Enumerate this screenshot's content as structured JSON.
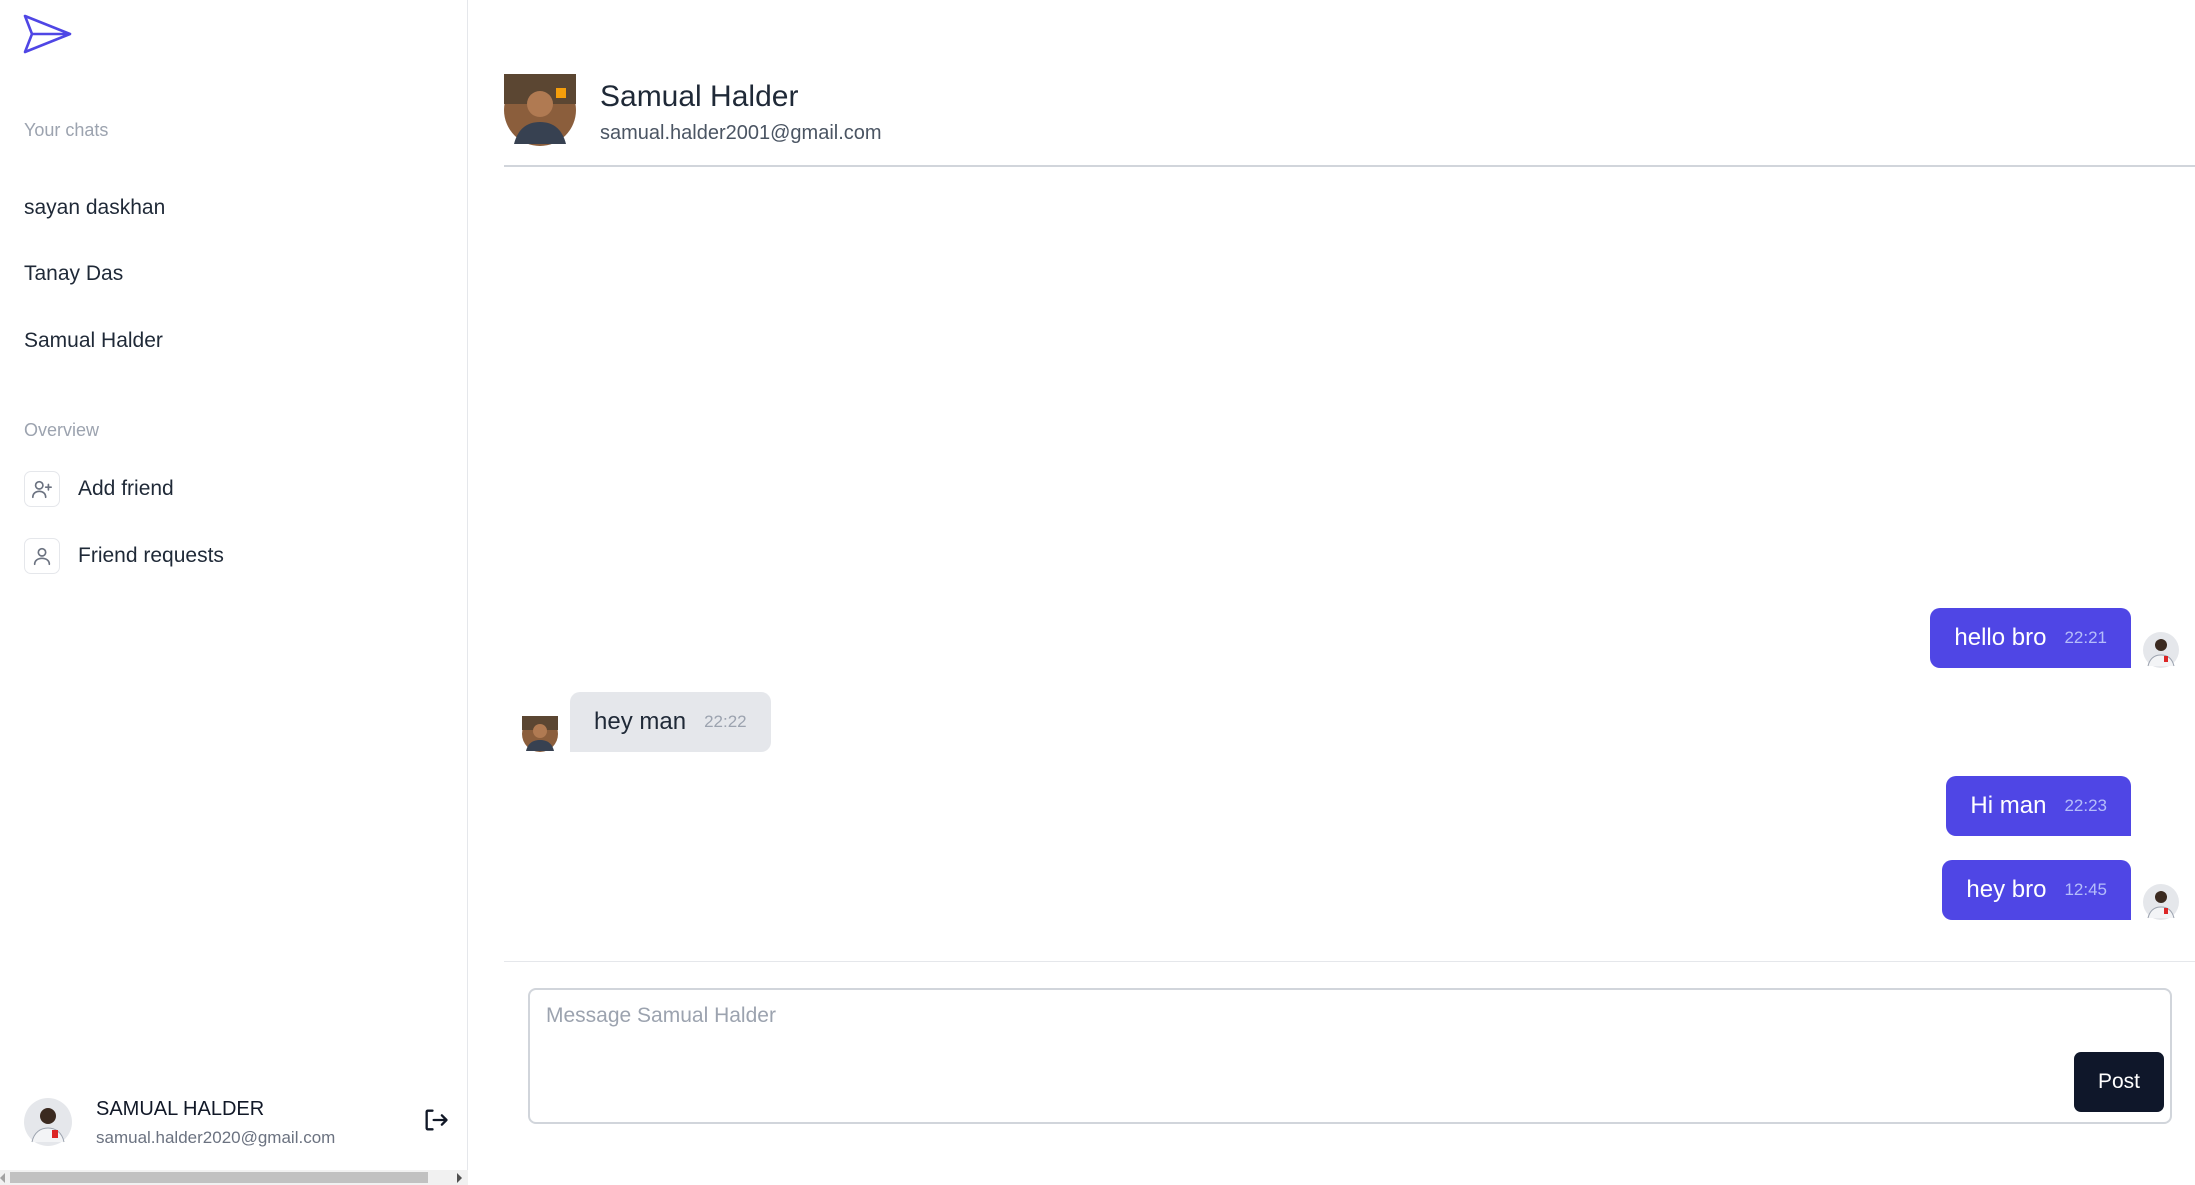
{
  "sidebar": {
    "your_chats_label": "Your chats",
    "chats": [
      {
        "name": "sayan daskhan"
      },
      {
        "name": "Tanay Das"
      },
      {
        "name": "Samual Halder"
      }
    ],
    "overview_label": "Overview",
    "nav": [
      {
        "label": "Add friend",
        "icon": "user-plus-icon"
      },
      {
        "label": "Friend requests",
        "icon": "user-icon"
      }
    ],
    "profile": {
      "name": "SAMUAL HALDER",
      "email": "samual.halder2020@gmail.com"
    }
  },
  "chat": {
    "partner_name": "Samual Halder",
    "partner_email": "samual.halder2001@gmail.com",
    "messages": [
      {
        "direction": "out",
        "text": "hello bro",
        "time": "22:21"
      },
      {
        "direction": "in",
        "text": "hey man",
        "time": "22:22"
      },
      {
        "direction": "out",
        "text": "Hi man",
        "time": "22:23"
      },
      {
        "direction": "out",
        "text": "hey bro",
        "time": "12:45"
      }
    ],
    "composer": {
      "placeholder": "Message Samual Halder",
      "post_label": "Post"
    }
  },
  "colors": {
    "accent": "#4f46e5",
    "incoming_bubble": "#e5e7eb",
    "post_button": "#0f172a"
  }
}
